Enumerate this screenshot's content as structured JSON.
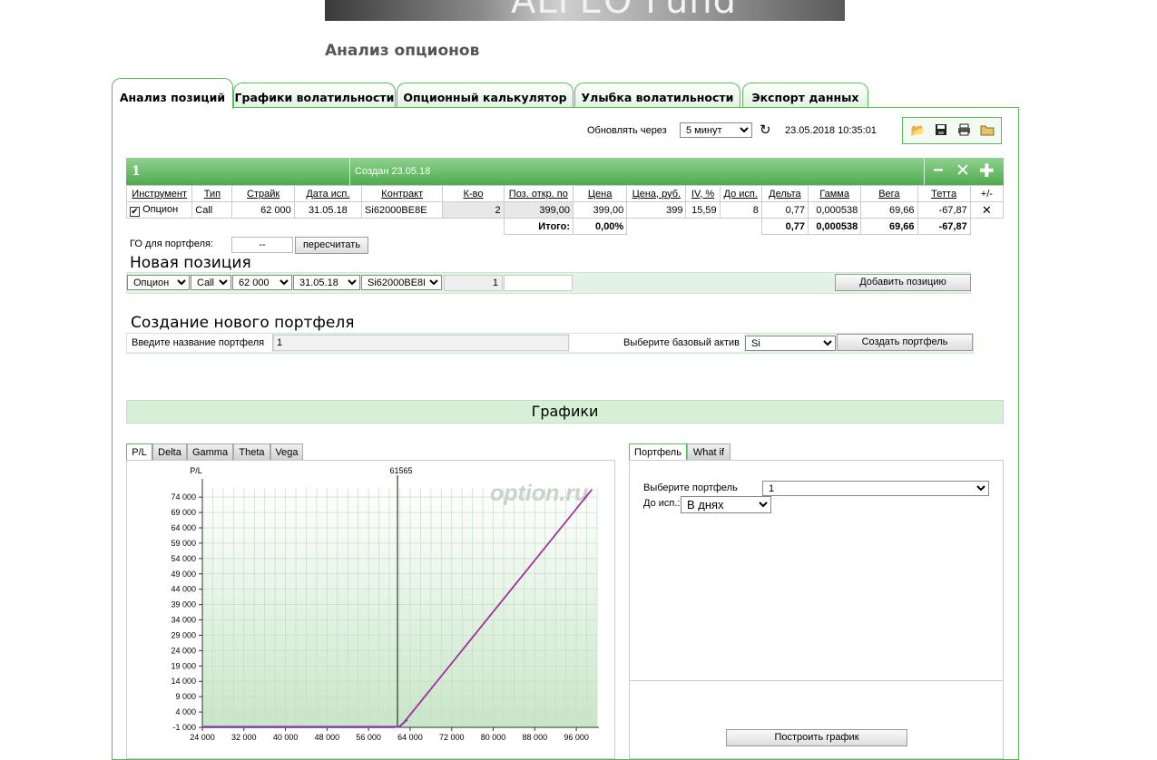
{
  "header": {
    "banner_text": "ALFEO Fund",
    "page_title": "Анализ опционов"
  },
  "tabs": [
    {
      "label": "Анализ позиций",
      "active": true
    },
    {
      "label": "Графики волатильности",
      "active": false
    },
    {
      "label": "Опционный калькулятор",
      "active": false
    },
    {
      "label": "Улыбка волатильности",
      "active": false
    },
    {
      "label": "Экспорт данных",
      "active": false
    }
  ],
  "refresh": {
    "label": "Обновлять через",
    "interval": "5 минут",
    "timestamp": "23.05.2018 10:35:01"
  },
  "toolbar_icons": [
    "open-folder-icon",
    "save-icon",
    "print-icon",
    "export-folder-icon"
  ],
  "portfolio": {
    "name": "1",
    "created": "Создан 23.05.18",
    "columns": [
      "Инструмент",
      "Тип",
      "Страйк",
      "Дата исп.",
      "Контракт",
      "К-во",
      "Поз. откр. по",
      "Цена",
      "Цена, руб.",
      "IV, %",
      "До исп.",
      "Дельта",
      "Гамма",
      "Вега",
      "Тетта",
      "+/-"
    ],
    "rows": [
      {
        "checked": true,
        "instrument": "Опцион",
        "type": "Call",
        "strike": "62 000",
        "expiry": "31.05.18",
        "contract": "Si62000BE8E",
        "qty": "2",
        "open_price": "399,00",
        "price": "399,00",
        "price_rub": "399",
        "iv": "15,59",
        "days": "8",
        "delta": "0,77",
        "gamma": "0,000538",
        "vega": "69,66",
        "theta": "-67,87"
      }
    ],
    "totals": {
      "label": "Итого:",
      "pct": "0,00%",
      "delta": "0,77",
      "gamma": "0,000538",
      "vega": "69,66",
      "theta": "-67,87"
    },
    "margin_label": "ГО для портфеля:",
    "margin_value": "--",
    "recalc_button": "пересчитать"
  },
  "new_position": {
    "title": "Новая позиция",
    "instrument": "Опцион",
    "type": "Call",
    "strike": "62 000",
    "expiry": "31.05.18",
    "contract": "Si62000BE8E",
    "qty": "1",
    "add_button": "Добавить позицию"
  },
  "new_portfolio": {
    "title": "Создание нового портфеля",
    "name_label": "Введите название портфеля",
    "name_value": "1",
    "asset_label": "Выберите базовый актив",
    "asset_value": "Si",
    "create_button": "Создать портфель"
  },
  "charts": {
    "title": "Графики",
    "tabs": [
      "P/L",
      "Delta",
      "Gamma",
      "Theta",
      "Vega"
    ],
    "right_tabs": [
      "Портфель",
      "What if"
    ],
    "select_portfolio_label": "Выберите портфель",
    "select_portfolio_value": "1",
    "expiry_label": "До исп.:",
    "expiry_value": "В днях",
    "build_button": "Построить график",
    "watermark": "option.ru"
  },
  "chart_data": {
    "type": "line",
    "ylabel": "P/L",
    "marker_label": "61565",
    "marker_x": 61565,
    "xlim": [
      24000,
      100000
    ],
    "ylim": [
      -1000,
      77000
    ],
    "x_ticks": [
      "24 000",
      "32 000",
      "40 000",
      "48 000",
      "56 000",
      "64 000",
      "72 000",
      "80 000",
      "88 000",
      "96 000"
    ],
    "x_tick_values": [
      24000,
      32000,
      40000,
      48000,
      56000,
      64000,
      72000,
      80000,
      88000,
      96000
    ],
    "y_ticks": [
      "74 000",
      "69 000",
      "64 000",
      "59 000",
      "54 000",
      "49 000",
      "44 000",
      "39 000",
      "34 000",
      "29 000",
      "24 000",
      "19 000",
      "14 000",
      "9 000",
      "4 000",
      "-1 000"
    ],
    "y_tick_values": [
      74000,
      69000,
      64000,
      59000,
      54000,
      49000,
      44000,
      39000,
      34000,
      29000,
      24000,
      19000,
      14000,
      9000,
      4000,
      -1000
    ],
    "series": [
      {
        "color": "#a0309a",
        "x": [
          24000,
          62000,
          63000,
          99000
        ],
        "y": [
          -800,
          -800,
          1000,
          76500
        ]
      },
      {
        "color": "#3b6fd8",
        "x": [
          24000,
          61000,
          62000,
          63500
        ],
        "y": [
          -1000,
          -1000,
          -600,
          1500
        ]
      }
    ],
    "accent_color": "#5cb85c"
  }
}
